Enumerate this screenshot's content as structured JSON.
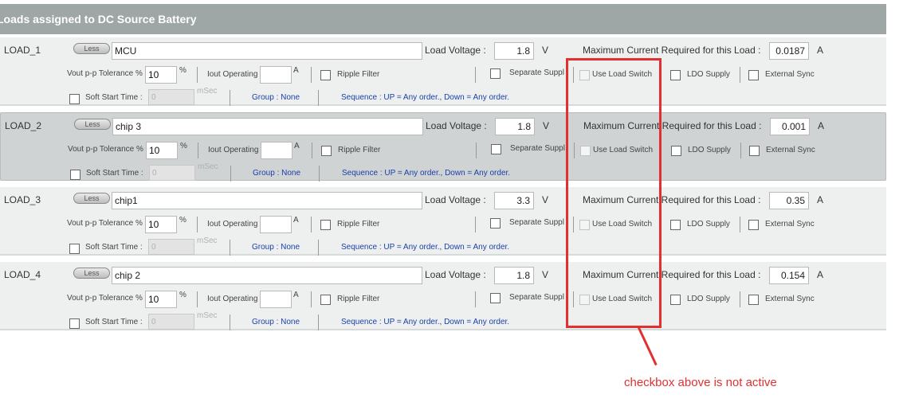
{
  "header": {
    "title": "Loads assigned to DC Source Battery"
  },
  "labels": {
    "less": "Less",
    "load_voltage": "Load Voltage :",
    "volt_unit": "V",
    "max_current": "Maximum Current Required for this Load :",
    "amp_unit": "A",
    "vout_tolerance": "Vout p-p Tolerance %",
    "percent": "%",
    "iout_operating": "Iout Operating",
    "iout_unit": "A",
    "ripple_filter": "Ripple Filter",
    "separate_supply": "Separate Suppl",
    "use_load_switch": "Use Load Switch",
    "ldo_supply": "LDO Supply",
    "external_sync": "External Sync",
    "soft_start": "Soft Start Time :",
    "msec": "mSec",
    "group": "Group : None",
    "sequence": "Sequence : UP = Any order., Down = Any order."
  },
  "loads": [
    {
      "id": "LOAD_1",
      "name": "MCU",
      "voltage": "1.8",
      "current": "0.0187",
      "tolerance": "10",
      "soft_start": "0"
    },
    {
      "id": "LOAD_2",
      "name": "chip 3",
      "voltage": "1.8",
      "current": "0.001",
      "tolerance": "10",
      "soft_start": "0"
    },
    {
      "id": "LOAD_3",
      "name": "chip1",
      "voltage": "3.3",
      "current": "0.35",
      "tolerance": "10",
      "soft_start": "0"
    },
    {
      "id": "LOAD_4",
      "name": "chip 2",
      "voltage": "1.8",
      "current": "0.154",
      "tolerance": "10",
      "soft_start": "0"
    }
  ],
  "annotation": {
    "text": "checkbox above is not active",
    "color": "#e23030"
  }
}
